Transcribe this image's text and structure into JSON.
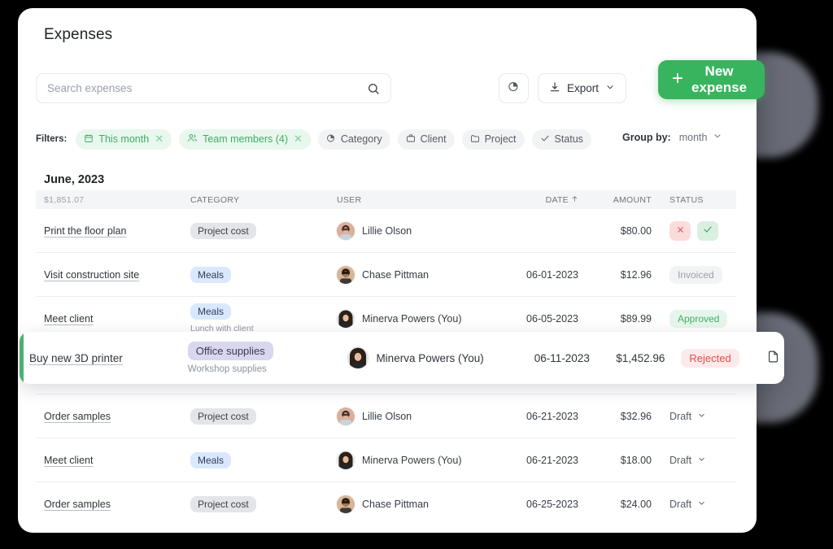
{
  "page": {
    "title": "Expenses"
  },
  "search": {
    "placeholder": "Search expenses",
    "value": "",
    "icon": "search-icon"
  },
  "toolbar": {
    "chart_icon": "pie-chart-icon",
    "export_label": "Export",
    "export_icon": "download-icon",
    "export_chevron": "chevron-down-icon",
    "new_expense_label": "New expense",
    "new_expense_icon": "plus-icon",
    "accent_color": "#38b45e"
  },
  "filters": {
    "label": "Filters:",
    "chips": [
      {
        "label": "This month",
        "icon": "calendar-icon",
        "active": true,
        "removable": true
      },
      {
        "label": "Team members (4)",
        "icon": "users-icon",
        "active": true,
        "removable": true
      },
      {
        "label": "Category",
        "icon": "pie-chart-icon",
        "active": false,
        "removable": false
      },
      {
        "label": "Client",
        "icon": "briefcase-icon",
        "active": false,
        "removable": false
      },
      {
        "label": "Project",
        "icon": "folder-icon",
        "active": false,
        "removable": false
      },
      {
        "label": "Status",
        "icon": "check-icon",
        "active": false,
        "removable": false
      }
    ]
  },
  "group_by": {
    "label": "Group by:",
    "value": "month",
    "chevron": "chevron-down-icon"
  },
  "table": {
    "group_title": "June, 2023",
    "group_total": "$1,851.07",
    "columns": {
      "category": "CATEGORY",
      "user": "USER",
      "date": "DATE",
      "date_sort_icon": "arrow-up-icon",
      "amount": "AMOUNT",
      "status": "STATUS"
    },
    "rows": [
      {
        "name": "Print the floor plan",
        "category": "Project cost",
        "category_color": "gray",
        "note": "",
        "user": "Lillie Olson",
        "avatar": "lillie",
        "date": "",
        "amount": "$80.00",
        "status_type": "actions",
        "status": "",
        "reject_icon": "close-icon",
        "approve_icon": "check-icon"
      },
      {
        "name": "Visit construction site",
        "category": "Meals",
        "category_color": "blue",
        "note": "",
        "user": "Chase Pittman",
        "avatar": "chase",
        "date": "06-01-2023",
        "amount": "$12.96",
        "status_type": "invoiced",
        "status": "Invoiced"
      },
      {
        "name": "Meet client ",
        "category": "Meals",
        "category_color": "blue",
        "note": "Lunch with client",
        "user": "Minerva Powers (You)",
        "avatar": "minerva",
        "date": "06-05-2023",
        "amount": "$89.99",
        "status_type": "approved",
        "status": "Approved"
      },
      {
        "name": "Order samples",
        "category": "Project cost",
        "category_color": "gray",
        "note": "",
        "user": "Lillie Olson",
        "avatar": "lillie",
        "date": "06-21-2023",
        "amount": "$32.96",
        "status_type": "draft",
        "status": "Draft",
        "chevron": "chevron-down-icon"
      },
      {
        "name": "Meet client",
        "category": "Meals",
        "category_color": "blue",
        "note": "",
        "user": "Minerva Powers (You)",
        "avatar": "minerva",
        "date": "06-21-2023",
        "amount": "$18.00",
        "status_type": "draft",
        "status": "Draft",
        "chevron": "chevron-down-icon"
      },
      {
        "name": "Order samples",
        "category": "Project cost",
        "category_color": "gray",
        "note": "",
        "user": "Chase Pittman",
        "avatar": "chase",
        "date": "06-25-2023",
        "amount": "$24.00",
        "status_type": "draft",
        "status": "Draft",
        "chevron": "chevron-down-icon"
      }
    ],
    "highlighted_row": {
      "name": "Buy new 3D printer",
      "category": "Office supplies",
      "category_color": "purple",
      "note": "Workshop supplies",
      "user": "Minerva Powers (You)",
      "avatar": "minerva",
      "date": "06-11-2023",
      "amount": "$1,452.96",
      "status": "Rejected",
      "attachment_icon": "document-icon",
      "accent_color": "#4cb06f"
    }
  }
}
